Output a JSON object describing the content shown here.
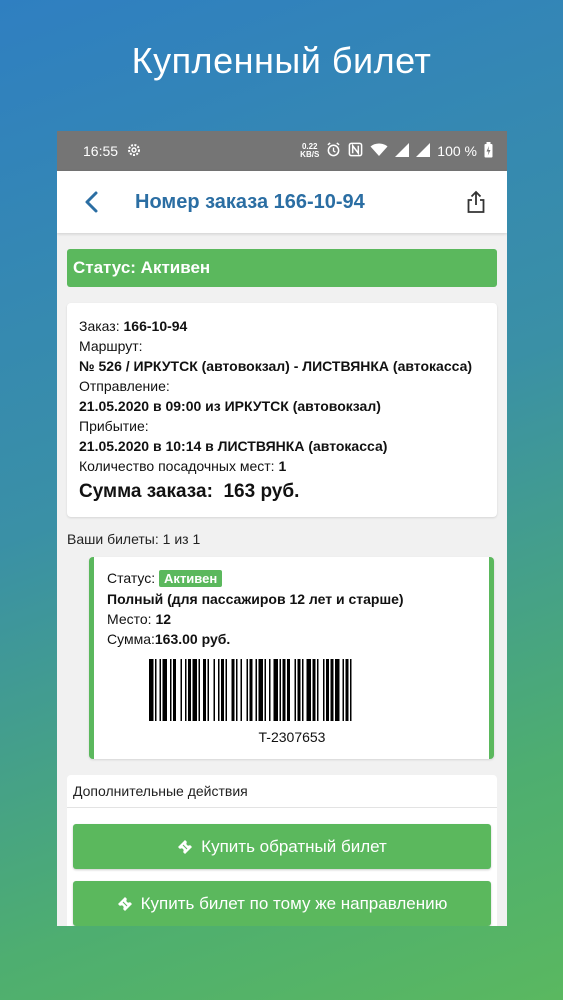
{
  "promo": {
    "title": "Купленный билет"
  },
  "statusbar": {
    "time": "16:55",
    "speed_value": "0.22",
    "speed_unit": "KB/S",
    "battery": "100 %"
  },
  "appbar": {
    "title": "Номер заказа 166-10-94"
  },
  "status_banner": "Статус: Активен",
  "order": {
    "order_label": "Заказ:",
    "order_number": "166-10-94",
    "route_label": "Маршрут:",
    "route_value": "№ 526 / ИРКУТСК (автовокзал) - ЛИСТВЯНКА (автокасса)",
    "departure_label": "Отправление:",
    "departure_value": "21.05.2020 в 09:00 из ИРКУТСК (автовокзал)",
    "arrival_label": "Прибытие:",
    "arrival_value": "21.05.2020 в 10:14 в ЛИСТВЯНКА (автокасса)",
    "seats_label": "Количество посадочных мест:",
    "seats_value": "1",
    "sum_label": "Сумма заказа:",
    "sum_value": "163 руб."
  },
  "tickets_caption": "Ваши билеты: 1 из 1",
  "ticket": {
    "status_label": "Статус:",
    "status_value": "Активен",
    "fare": "Полный (для пассажиров 12 лет и старше)",
    "seat_label": "Место:",
    "seat_value": "12",
    "sum_label": "Сумма:",
    "sum_value": "163.00 руб.",
    "number": "T-2307653"
  },
  "extra": {
    "title": "Дополнительные действия"
  },
  "actions": {
    "return_ticket": "Купить обратный билет",
    "same_direction": "Купить билет по тому же направлению"
  },
  "icons": {
    "back": "chevron-left-icon",
    "share": "share-icon",
    "ticket": "ticket-icon"
  },
  "colors": {
    "accent_green": "#5bb85d",
    "title_blue": "#2b6ea3",
    "statusbar": "#757575"
  }
}
